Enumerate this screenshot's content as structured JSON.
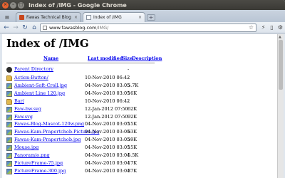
{
  "window": {
    "title": "Index of /IMG - Google Chrome"
  },
  "tabs": [
    {
      "label": "Fawas Technical Blog",
      "close": "×"
    },
    {
      "label": "Index of /IMG",
      "close": "×"
    }
  ],
  "newtab": "+",
  "toolbar": {
    "back": "←",
    "forward": "→",
    "reload": "↻",
    "home": "⌂",
    "url_host": "www.fawasblog.com",
    "url_path": "/IMG/",
    "star": "☆"
  },
  "page": {
    "heading": "Index of /IMG",
    "columns": {
      "name": "Name",
      "modified": "Last modified",
      "size": "Size",
      "description": "Description"
    },
    "parent": {
      "name": "Parent Directory",
      "size": "-"
    },
    "rows": [
      {
        "name": "Action-Button/",
        "date": "10-Nov-2010 06:42",
        "size": "-",
        "type": "folder"
      },
      {
        "name": "Ambient-Soft-Croll.jpg",
        "date": "04-Nov-2010 03:05",
        "size": "5.7K",
        "type": "img"
      },
      {
        "name": "Ambient Line 120.jpg",
        "date": "04-Nov-2010 03:05",
        "size": "16K",
        "type": "img"
      },
      {
        "name": "Bar/",
        "date": "10-Nov-2010 06:42",
        "size": "-",
        "type": "folder"
      },
      {
        "name": "Faw-bw.svg",
        "date": "12-Jan-2012 07:50",
        "size": "62K",
        "type": "img"
      },
      {
        "name": "Faw.svg",
        "date": "12-Jan-2012 07:50",
        "size": "92K",
        "type": "img"
      },
      {
        "name": "Fawas-Blog-Mascot-120w.png",
        "date": "04-Nov-2010 03:05",
        "size": "15K",
        "type": "img"
      },
      {
        "name": "Fawas-Kam-Prapertchob-Picture.jpg",
        "date": "04-Nov-2010 03:05",
        "size": "63K",
        "type": "img"
      },
      {
        "name": "Fawas-Kam-Prapertchob.jpg",
        "date": "04-Nov-2010 03:05",
        "size": "59K",
        "type": "img"
      },
      {
        "name": "Mouse.jpg",
        "date": "04-Nov-2010 03:05",
        "size": "15K",
        "type": "img"
      },
      {
        "name": "Panoramio.png",
        "date": "04-Nov-2010 03:04",
        "size": "5.5K",
        "type": "img"
      },
      {
        "name": "PictureFrame-75.jpg",
        "date": "04-Nov-2010 03:04",
        "size": "17K",
        "type": "img"
      },
      {
        "name": "PictureFrame-300.jpg",
        "date": "04-Nov-2010 03:04",
        "size": "37K",
        "type": "img"
      }
    ]
  }
}
